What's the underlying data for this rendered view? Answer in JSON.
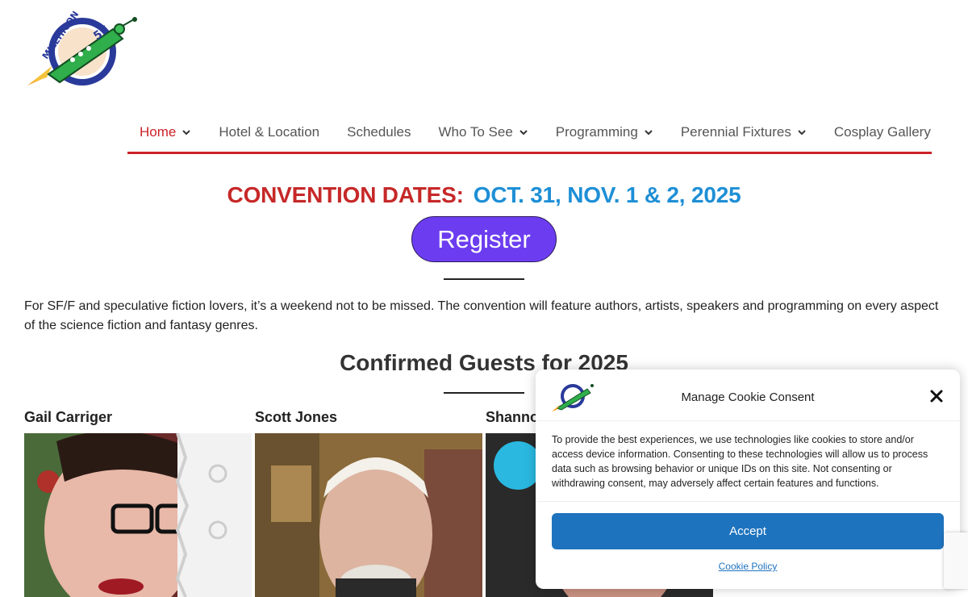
{
  "logo": {
    "alt": "MileHiCon 57",
    "text": "MILEHICON",
    "number": "57"
  },
  "nav": {
    "items": [
      {
        "label": "Home",
        "dropdown": true,
        "active": true
      },
      {
        "label": "Hotel & Location",
        "dropdown": false
      },
      {
        "label": "Schedules",
        "dropdown": false
      },
      {
        "label": "Who To See",
        "dropdown": true
      },
      {
        "label": "Programming",
        "dropdown": true
      },
      {
        "label": "Perennial Fixtures",
        "dropdown": true
      },
      {
        "label": "Cosplay Gallery",
        "dropdown": false
      }
    ]
  },
  "convention": {
    "dates_label": "CONVENTION DATES:",
    "dates_value": "OCT. 31, NOV. 1 & 2, 2025",
    "register_label": "Register"
  },
  "intro": "For SF/F and speculative fiction lovers, it’s a weekend not to be missed. The convention will feature authors, artists, speakers and programming on every aspect of the science fiction and fantasy genres.",
  "guests": {
    "title": "Confirmed Guests for 2025",
    "items": [
      {
        "name": "Gail Carriger"
      },
      {
        "name": "Scott Jones"
      },
      {
        "name": "Shannon"
      }
    ]
  },
  "cookie": {
    "title": "Manage Cookie Consent",
    "text": "To provide the best experiences, we use technologies like cookies to store and/or access device information. Consenting to these technologies will allow us to process data such as browsing behavior or unique IDs on this site. Not consenting or withdrawing consent, may adversely affect certain features and functions.",
    "accept_label": "Accept",
    "policy_label": "Cookie Policy"
  },
  "colors": {
    "accent_red": "#cc2229",
    "accent_blue": "#1e8fd6",
    "register_purple": "#6c3df0",
    "accept_blue": "#1e73be"
  }
}
